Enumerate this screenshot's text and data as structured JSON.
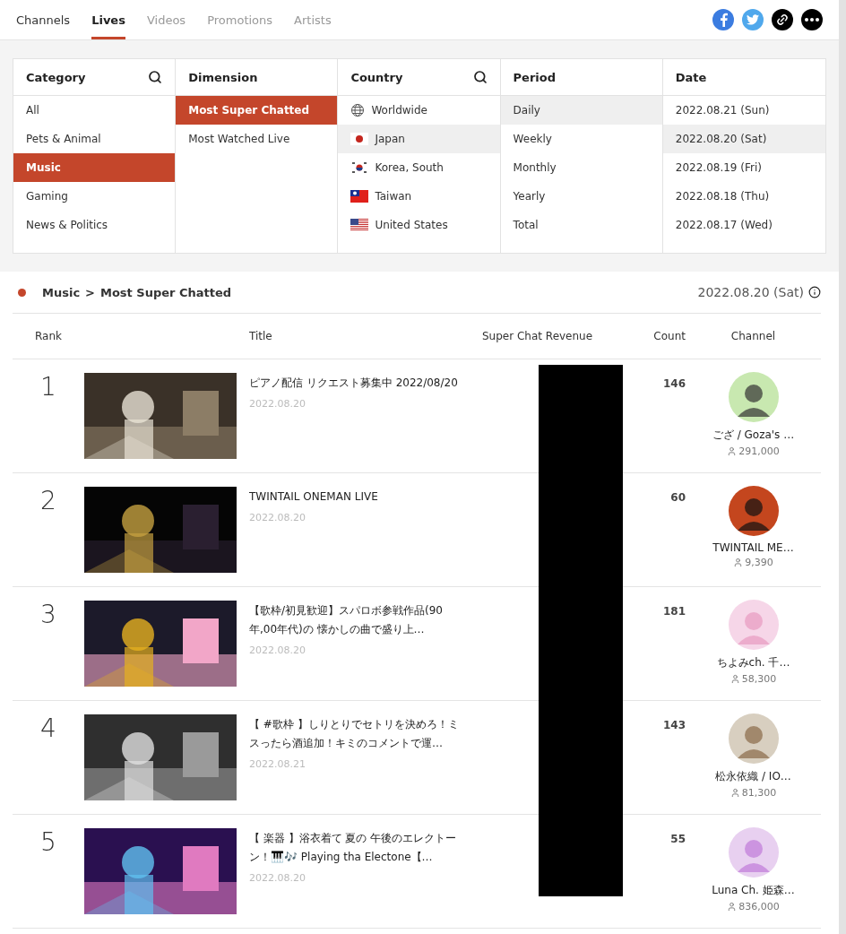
{
  "nav": {
    "tabs": [
      {
        "label": "Channels",
        "selected": false,
        "disabled": false
      },
      {
        "label": "Lives",
        "selected": true,
        "disabled": false
      },
      {
        "label": "Videos",
        "selected": false,
        "disabled": true
      },
      {
        "label": "Promotions",
        "selected": false,
        "disabled": true
      },
      {
        "label": "Artists",
        "selected": false,
        "disabled": true
      }
    ]
  },
  "filters": [
    {
      "title": "Category",
      "searchable": true,
      "kind": "accent",
      "items": [
        {
          "label": "All",
          "selected": false
        },
        {
          "label": "Pets & Animal",
          "selected": false
        },
        {
          "label": "Music",
          "selected": true
        },
        {
          "label": "Gaming",
          "selected": false
        },
        {
          "label": "News & Politics",
          "selected": false
        }
      ]
    },
    {
      "title": "Dimension",
      "searchable": false,
      "kind": "accent",
      "items": [
        {
          "label": "Most Super Chatted",
          "selected": true
        },
        {
          "label": "Most Watched Live",
          "selected": false
        }
      ]
    },
    {
      "title": "Country",
      "searchable": true,
      "kind": "muted",
      "items": [
        {
          "label": "Worldwide",
          "selected": false,
          "kind": "globe"
        },
        {
          "label": "Japan",
          "selected": true,
          "kind": "flag"
        },
        {
          "label": "Korea, South",
          "selected": false,
          "kind": "flag"
        },
        {
          "label": "Taiwan",
          "selected": false,
          "kind": "flag"
        },
        {
          "label": "United States",
          "selected": false,
          "kind": "flag"
        }
      ]
    },
    {
      "title": "Period",
      "searchable": false,
      "kind": "muted",
      "items": [
        {
          "label": "Daily",
          "selected": true
        },
        {
          "label": "Weekly",
          "selected": false
        },
        {
          "label": "Monthly",
          "selected": false
        },
        {
          "label": "Yearly",
          "selected": false
        },
        {
          "label": "Total",
          "selected": false
        }
      ]
    },
    {
      "title": "Date",
      "searchable": false,
      "kind": "muted",
      "items": [
        {
          "label": "2022.08.21 (Sun)",
          "selected": false
        },
        {
          "label": "2022.08.20 (Sat)",
          "selected": true
        },
        {
          "label": "2022.08.19 (Fri)",
          "selected": false
        },
        {
          "label": "2022.08.18 (Thu)",
          "selected": false
        },
        {
          "label": "2022.08.17 (Wed)",
          "selected": false
        }
      ]
    }
  ],
  "breadcrumb": {
    "category": "Music",
    "separator": ">",
    "dimension": "Most Super Chatted",
    "date": "2022.08.20 (Sat)"
  },
  "table": {
    "columns": [
      "Rank",
      "Title",
      "Super Chat Revenue",
      "Count",
      "Channel"
    ],
    "revenue_redacted": true,
    "rows": [
      {
        "rank": "1",
        "title": "ピアノ配信  リクエスト募集中 2022/08/20",
        "date": "2022.08.20",
        "count": "146",
        "channel": "ござ / Goza's …",
        "subscribers": "291,000"
      },
      {
        "rank": "2",
        "title": "TWINTAIL ONEMAN LIVE",
        "date": "2022.08.20",
        "count": "60",
        "channel": "TWINTAIL ME…",
        "subscribers": "9,390"
      },
      {
        "rank": "3",
        "title": "【歌枠/初見歓迎】スパロボ参戦作品(90年,00年代)の 懐かしの曲で盛り上…",
        "date": "2022.08.20",
        "count": "181",
        "channel": "ちよみch. 千…",
        "subscribers": "58,300"
      },
      {
        "rank": "4",
        "title": "【 #歌枠 】しりとりでセトリを決めろ！ミスったら酒追加！キミのコメントで運…",
        "date": "2022.08.21",
        "count": "143",
        "channel": "松永依織 / IO…",
        "subscribers": "81,300"
      },
      {
        "rank": "5",
        "title": "【 楽器 】浴衣着て 夏の 午後のエレクトーン！🎹🎶 Playing tha Electone【…",
        "date": "2022.08.20",
        "count": "55",
        "channel": "Luna Ch. 姫森…",
        "subscribers": "836,000"
      }
    ]
  }
}
